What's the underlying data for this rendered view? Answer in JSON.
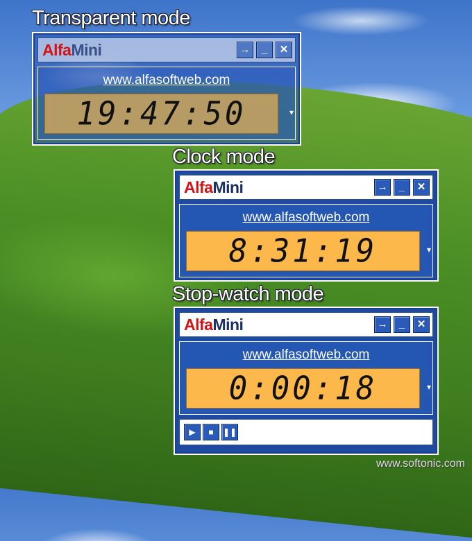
{
  "captions": {
    "transparent": "Transparent mode",
    "clock": "Clock mode",
    "stopwatch": "Stop-watch mode"
  },
  "brand": {
    "alfa": "Alfa",
    "mini": "Mini"
  },
  "url": "www.alfasoftweb.com",
  "buttons": {
    "goto": "→",
    "minimize": "_",
    "close": "✕",
    "dropdown": "▾"
  },
  "controls": {
    "play": "▶",
    "stop": "■",
    "pause": "❚❚"
  },
  "widgets": {
    "transparent": {
      "time": "19:47:50"
    },
    "clock": {
      "time": "8:31:19"
    },
    "stopwatch": {
      "time": "0:00:18"
    }
  },
  "watermark": "www.softonic.com",
  "colors": {
    "title_red": "#d41414",
    "panel_blue": "#2457b3",
    "display_orange": "#fcb84a"
  }
}
